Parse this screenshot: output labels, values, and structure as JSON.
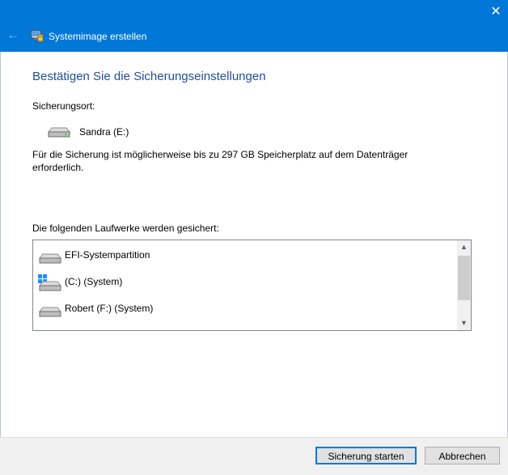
{
  "window": {
    "title": "Systemimage erstellen",
    "accent_color": "#0078d7",
    "close_icon": "close-icon",
    "back_icon": "back-arrow-icon"
  },
  "page": {
    "heading": "Bestätigen Sie die Sicherungseinstellungen",
    "location_label": "Sicherungsort:",
    "location_value": "Sandra (E:)",
    "info_text": "Für die Sicherung ist möglicherweise bis zu 297 GB Speicherplatz auf dem Datenträger erforderlich.",
    "drives_label": "Die folgenden Laufwerke werden gesichert:",
    "drives": [
      {
        "label": "EFI-Systempartition",
        "icon": "drive-icon"
      },
      {
        "label": "(C:) (System)",
        "icon": "windows-drive-icon"
      },
      {
        "label": "Robert (F:) (System)",
        "icon": "drive-icon"
      }
    ]
  },
  "buttons": {
    "start": "Sicherung starten",
    "cancel": "Abbrechen"
  }
}
